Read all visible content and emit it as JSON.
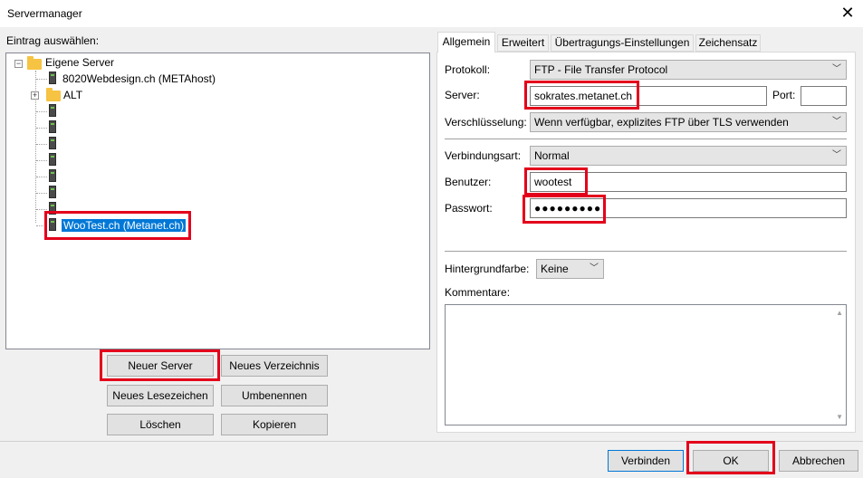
{
  "window": {
    "title": "Servermanager",
    "close_glyph": "✕"
  },
  "left": {
    "label": "Eintrag auswählen:",
    "tree": {
      "root_label": "Eigene Server",
      "root_expander": "−",
      "server1_label": "8020Webdesign.ch (METAhost)",
      "folder_expander": "+",
      "folder_label": "ALT",
      "selected_label": "WooTest.ch (Metanet.ch)"
    },
    "buttons": {
      "new_server": "Neuer Server",
      "new_folder": "Neues Verzeichnis",
      "new_bookmark": "Neues Lesezeichen",
      "rename": "Umbenennen",
      "delete": "Löschen",
      "copy": "Kopieren"
    }
  },
  "tabs": [
    "Allgemein",
    "Erweitert",
    "Übertragungs-Einstellungen",
    "Zeichensatz"
  ],
  "form": {
    "protocol_label": "Protokoll:",
    "protocol_value": "FTP - File Transfer Protocol",
    "server_label": "Server:",
    "server_value": "sokrates.metanet.ch",
    "port_label": "Port:",
    "port_value": "",
    "encryption_label": "Verschlüsselung:",
    "encryption_value": "Wenn verfügbar, explizites FTP über TLS verwenden",
    "connection_label": "Verbindungsart:",
    "connection_value": "Normal",
    "user_label": "Benutzer:",
    "user_value": "wootest",
    "password_label": "Passwort:",
    "password_value": "●●●●●●●●●",
    "bgcolor_label": "Hintergrundfarbe:",
    "bgcolor_value": "Keine",
    "comments_label": "Kommentare:",
    "dropdown_arrow": "﹀"
  },
  "footer": {
    "connect": "Verbinden",
    "ok": "OK",
    "cancel": "Abbrechen"
  },
  "colors": {
    "highlight": "#e3001b",
    "selection": "#0078d7"
  }
}
